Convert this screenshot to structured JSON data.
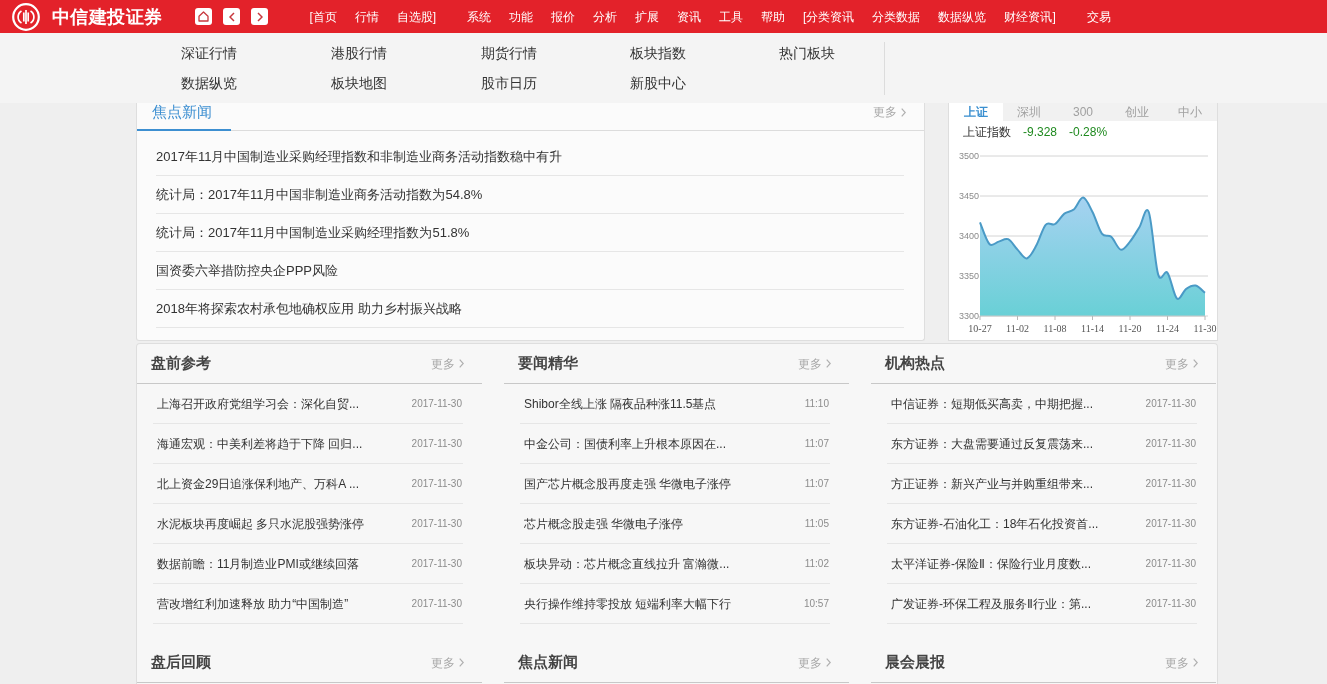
{
  "header": {
    "brand": "中信建投证券",
    "nav_groups": [
      {
        "items": [
          "[首页",
          "行情",
          "自选股]"
        ]
      },
      {
        "items": [
          "系统",
          "功能",
          "报价",
          "分析",
          "扩展",
          "资讯",
          "工具",
          "帮助",
          "[分类资讯",
          "分类数据",
          "数据纵览",
          "财经资讯]"
        ]
      },
      {
        "items": [
          "交易"
        ]
      }
    ]
  },
  "dropdown": {
    "rows": [
      [
        "深证行情",
        "港股行情",
        "期货行情",
        "板块指数",
        "热门板块"
      ],
      [
        "数据纵览",
        "板块地图",
        "股市日历",
        "新股中心"
      ]
    ]
  },
  "focus_news": {
    "tabs": [
      {
        "label": "焦点新闻",
        "selected": true
      }
    ],
    "more": "更多",
    "items": [
      "2017年11月中国制造业采购经理指数和非制造业商务活动指数稳中有升",
      "统计局：2017年11月中国非制造业商务活动指数为54.8%",
      "统计局：2017年11月中国制造业采购经理指数为51.8%",
      "国资委六举措防控央企PPP风险",
      "2018年将探索农村承包地确权应用 助力乡村振兴战略"
    ]
  },
  "index_panel": {
    "tabs": [
      {
        "label": "上证",
        "selected": true
      },
      {
        "label": "深圳",
        "selected": false
      },
      {
        "label": "300",
        "selected": false
      },
      {
        "label": "创业",
        "selected": false
      },
      {
        "label": "中小",
        "selected": false
      }
    ],
    "index_name": "上证指数",
    "change": "-9.328",
    "change_percent": "-0.28%",
    "chart_data": {
      "type": "area",
      "categories": [
        "10-27",
        null,
        null,
        null,
        "11-02",
        null,
        null,
        null,
        "11-08",
        null,
        null,
        null,
        "11-14",
        null,
        null,
        null,
        "11-20",
        null,
        null,
        null,
        "11-24",
        null,
        null,
        null,
        "11-30"
      ],
      "values": [
        3417,
        3390,
        3393,
        3396,
        3383,
        3372,
        3388,
        3414,
        3415,
        3428,
        3433,
        3448,
        3430,
        3403,
        3399,
        3383,
        3393,
        3411,
        3430,
        3352,
        3354,
        3322,
        3334,
        3338,
        3329
      ],
      "ylim": [
        3300,
        3500
      ],
      "yticks": [
        3300,
        3350,
        3400,
        3450,
        3500
      ],
      "grid": true
    }
  },
  "columns": [
    {
      "sections": [
        {
          "title": "盘前参考",
          "more": "更多",
          "items": [
            {
              "title": "上海召开政府党组学习会：深化自贸...",
              "date": "2017-11-30"
            },
            {
              "title": "海通宏观：中美利差将趋于下降 回归...",
              "date": "2017-11-30"
            },
            {
              "title": "北上资金29日追涨保利地产、万科A ...",
              "date": "2017-11-30"
            },
            {
              "title": "水泥板块再度崛起 多只水泥股强势涨停",
              "date": "2017-11-30"
            },
            {
              "title": "数据前瞻：11月制造业PMI或继续回落",
              "date": "2017-11-30"
            },
            {
              "title": "营改增红利加速释放 助力“中国制造”",
              "date": "2017-11-30"
            }
          ]
        },
        {
          "title": "盘后回顾",
          "more": "更多"
        }
      ]
    },
    {
      "sections": [
        {
          "title": "要闻精华",
          "more": "更多",
          "items": [
            {
              "title": "Shibor全线上涨 隔夜品种涨11.5基点",
              "date": "11:10"
            },
            {
              "title": "中金公司：国债利率上升根本原因在...",
              "date": "11:07"
            },
            {
              "title": "国产芯片概念股再度走强 华微电子涨停",
              "date": "11:07"
            },
            {
              "title": "芯片概念股走强 华微电子涨停",
              "date": "11:05"
            },
            {
              "title": "板块异动：芯片概念直线拉升 富瀚微...",
              "date": "11:02"
            },
            {
              "title": "央行操作维持零投放 短端利率大幅下行",
              "date": "10:57"
            }
          ]
        },
        {
          "title": "焦点新闻",
          "more": "更多"
        }
      ]
    },
    {
      "sections": [
        {
          "title": "机构热点",
          "more": "更多",
          "items": [
            {
              "title": "中信证券：短期低买高卖，中期把握...",
              "date": "2017-11-30"
            },
            {
              "title": "东方证券：大盘需要通过反复震荡来...",
              "date": "2017-11-30"
            },
            {
              "title": "方正证券：新兴产业与并购重组带来...",
              "date": "2017-11-30"
            },
            {
              "title": "东方证券-石油化工：18年石化投资首...",
              "date": "2017-11-30"
            },
            {
              "title": "太平洋证券-保险Ⅱ：保险行业月度数...",
              "date": "2017-11-30"
            },
            {
              "title": "广发证券-环保工程及服务Ⅱ行业：第...",
              "date": "2017-11-30"
            }
          ]
        },
        {
          "title": "晨会晨报",
          "more": "更多"
        }
      ]
    }
  ]
}
